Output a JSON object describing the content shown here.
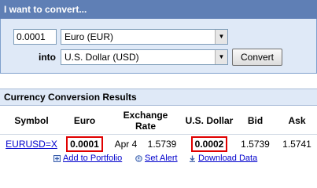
{
  "converter": {
    "title": "I want to convert...",
    "amount_value": "0.0001",
    "from_currency": "Euro (EUR)",
    "into_label": "into",
    "to_currency": "U.S. Dollar (USD)",
    "convert_label": "Convert"
  },
  "results": {
    "title": "Currency Conversion Results",
    "headers": {
      "symbol": "Symbol",
      "euro": "Euro",
      "rate_line1": "Exchange",
      "rate_line2": "Rate",
      "usd": "U.S. Dollar",
      "bid": "Bid",
      "ask": "Ask"
    },
    "row": {
      "symbol": "EURUSD=X",
      "euro": "0.0001",
      "date": "Apr 4",
      "rate": "1.5739",
      "usd": "0.0002",
      "bid": "1.5739",
      "ask": "1.5741"
    }
  },
  "footer": {
    "add_portfolio": "Add to Portfolio",
    "set_alert": "Set Alert",
    "download": "Download Data"
  },
  "colors": {
    "header_bar": "#5f7fb5",
    "panel_bg": "#dfe9f7",
    "link": "#0000cc",
    "highlight_box": "#e00000"
  }
}
